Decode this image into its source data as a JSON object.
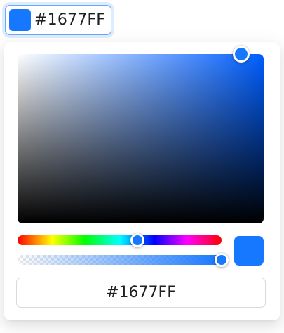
{
  "color_picker": {
    "current_hex": "#1677FF",
    "accent_color": "#1677FF",
    "hue_color": "#005EFF",
    "hue_fraction": 0.588,
    "saturation_fraction": 0.91,
    "brightness_fraction": 1.0,
    "alpha_fraction": 1.0,
    "trigger": {
      "label": "#1677FF"
    },
    "hex_input": {
      "value": "#1677FF"
    }
  }
}
